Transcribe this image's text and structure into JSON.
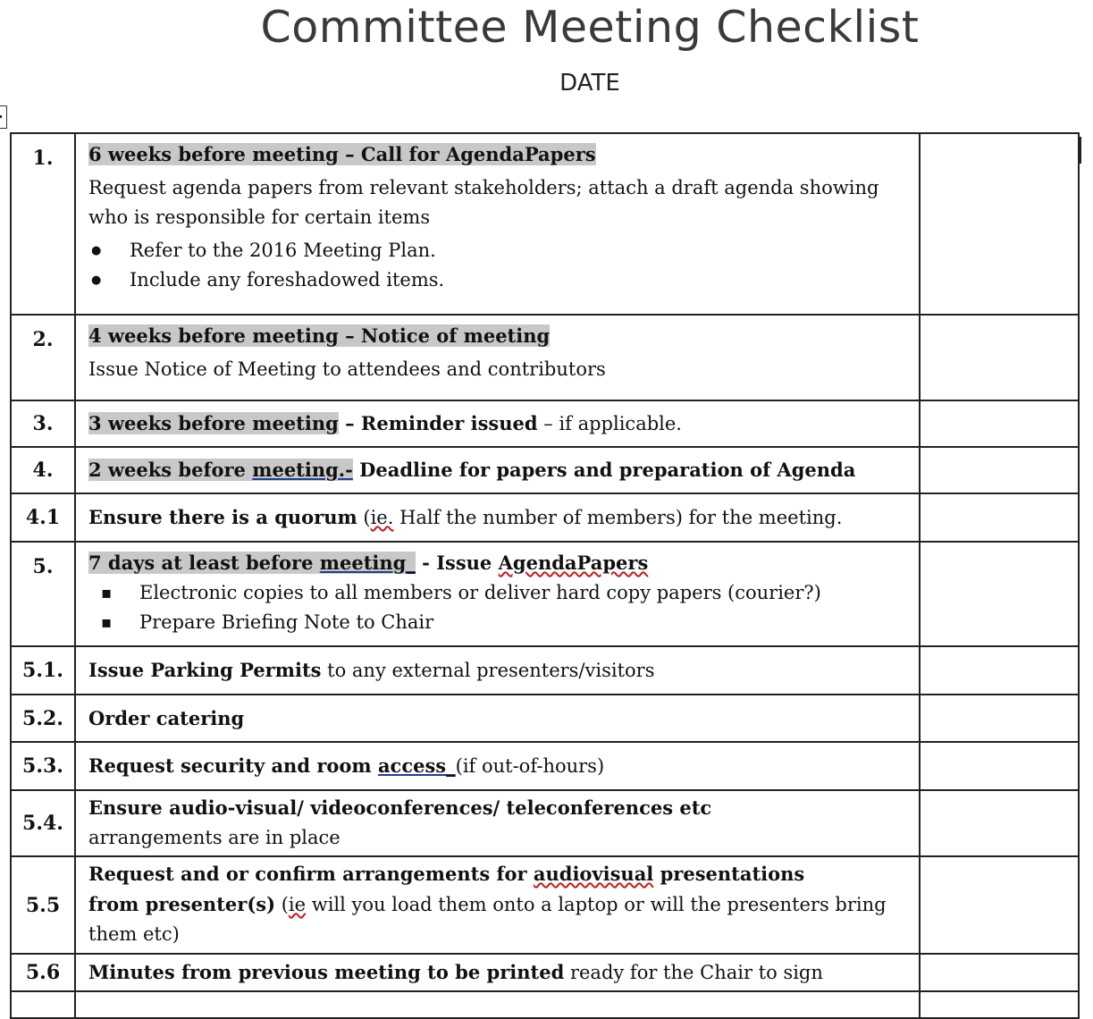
{
  "document": {
    "title": "Committee Meeting Checklist",
    "date_label": "DATE"
  },
  "colors": {
    "highlight": "#c8c8c8",
    "border": "#222222",
    "title": "#3a3a3a",
    "spellcheck_underline": "#c02020",
    "grammar_underline": "#1f3f8f"
  },
  "rows": [
    {
      "number": "1.",
      "heading": "6 weeks before meeting – Call for AgendaPapers",
      "text": "Request agenda papers from relevant stakeholders; attach a draft agenda showing who is responsible for certain items",
      "bullets": [
        "Refer to the 2016 Meeting Plan.",
        "Include any foreshadowed items."
      ],
      "check": ""
    },
    {
      "number": "2.",
      "heading": "4 weeks before meeting – Notice of meeting",
      "text": "Issue Notice of Meeting to attendees and contributors",
      "check": ""
    },
    {
      "number": "3.",
      "heading": "3 weeks before meeting",
      "heading_rest": " – Reminder issued",
      "text": " – if applicable.",
      "check": ""
    },
    {
      "number": "4.",
      "heading_pre": "2 weeks before ",
      "heading_link": "meeting.-",
      "heading_rest": " Deadline for papers and preparation of Agenda",
      "check": ""
    },
    {
      "number": "4.1",
      "heading": "Ensure there is a quorum",
      "text_pre": " (",
      "text_misspelled": "ie.",
      "text": " Half the number of members) for the meeting.",
      "check": ""
    },
    {
      "number": "5.",
      "heading_pre": "7 days at least before ",
      "heading_link": "meeting_",
      "heading_mid": " - Issue ",
      "heading_misspelled": "AgendaPapers",
      "bullets": [
        "Electronic copies to all members or deliver hard copy papers (courier?)",
        "Prepare Briefing Note to Chair"
      ],
      "check": ""
    },
    {
      "number": "5.1.",
      "heading": "Issue Parking Permits",
      "text": " to any external presenters/visitors",
      "check": ""
    },
    {
      "number": "5.2.",
      "heading": "Order catering",
      "check": ""
    },
    {
      "number": "5.3.",
      "heading": "Request security and room ",
      "heading_link": "access_",
      "text": "(if out-of-hours)",
      "check": ""
    },
    {
      "number": "5.4.",
      "heading": "Ensure audio-visual/ videoconferences/ teleconferences etc",
      "text": "arrangements are in place",
      "check": ""
    },
    {
      "number": "5.5",
      "heading_pre": "Request and or confirm arrangements for ",
      "heading_misspelled": "audiovisual",
      "heading_rest": " presentations",
      "heading_line2": "from presenter(s)",
      "text_pre": " (",
      "text_misspelled": "ie",
      "text": " will you load them onto a laptop or will the presenters bring them etc)",
      "check": ""
    },
    {
      "number": "5.6",
      "heading": "Minutes from previous meeting to be printed",
      "text": " ready for the Chair to sign",
      "check": ""
    }
  ]
}
